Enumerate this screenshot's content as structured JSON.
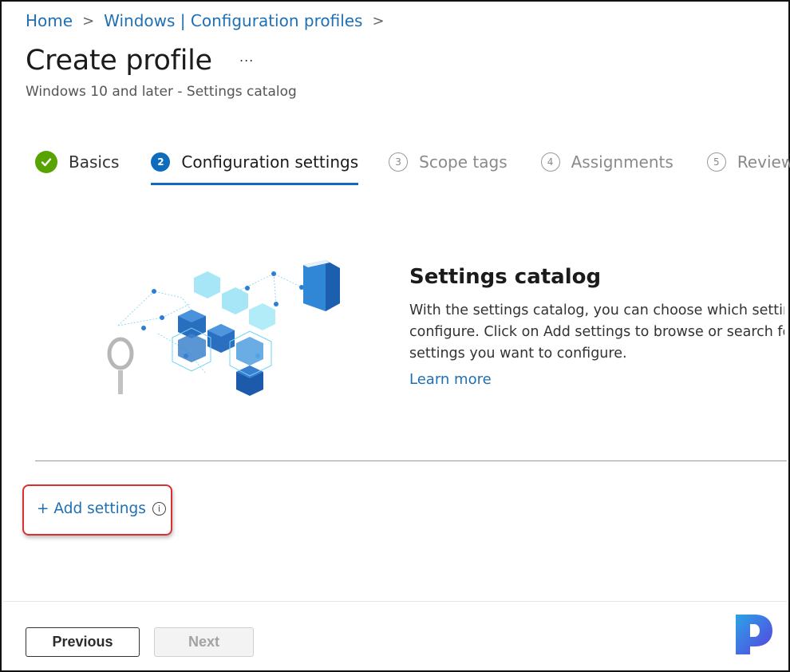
{
  "breadcrumb": {
    "items": [
      "Home",
      "Windows | Configuration profiles"
    ],
    "separator": ">"
  },
  "header": {
    "title": "Create profile",
    "more_label": "...",
    "subtitle": "Windows 10 and later - Settings catalog"
  },
  "wizard": {
    "steps": [
      {
        "number": "✓",
        "label": "Basics",
        "state": "completed"
      },
      {
        "number": "2",
        "label": "Configuration settings",
        "state": "active"
      },
      {
        "number": "3",
        "label": "Scope tags",
        "state": "pending"
      },
      {
        "number": "4",
        "label": "Assignments",
        "state": "pending"
      },
      {
        "number": "5",
        "label": "Review + create",
        "state": "pending"
      }
    ]
  },
  "catalog": {
    "illustration": "settings-catalog-illustration",
    "title": "Settings catalog",
    "description_lines": [
      "With the settings catalog, you can choose which settings you want to",
      "configure. Click on Add settings to browse or search for the",
      "settings you want to configure."
    ],
    "learn_more": "Learn more"
  },
  "actions": {
    "add_settings": "+ Add settings",
    "info_icon": "i"
  },
  "footer": {
    "previous": "Previous",
    "next": "Next",
    "next_disabled": true
  },
  "colors": {
    "accent": "#0f6cbd",
    "link": "#1f6fb5",
    "success": "#57a300",
    "highlight": "#d93030"
  }
}
